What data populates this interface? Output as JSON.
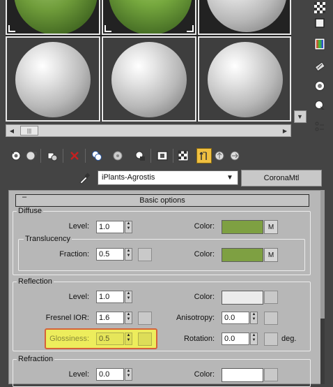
{
  "material": {
    "name": "iPlants-Agrostis",
    "type_button": "CoronaMtl"
  },
  "rollout": {
    "minus": "–",
    "title": "Basic options"
  },
  "diffuse": {
    "group": "Diffuse",
    "level_label": "Level:",
    "level_value": "1.0",
    "color_label": "Color:",
    "color": "#7ea042",
    "map_btn": "M"
  },
  "translucency": {
    "group": "Translucency",
    "fraction_label": "Fraction:",
    "fraction_value": "0.5",
    "color_label": "Color:",
    "color": "#7ea042",
    "map_btn": "M"
  },
  "reflection": {
    "group": "Reflection",
    "level_label": "Level:",
    "level_value": "1.0",
    "color_label": "Color:",
    "color": "#ececec",
    "fresnel_label": "Fresnel IOR:",
    "fresnel_value": "1.6",
    "anisotropy_label": "Anisotropy:",
    "anisotropy_value": "0.0",
    "glossiness_label": "Glossiness:",
    "glossiness_value": "0.5",
    "rotation_label": "Rotation:",
    "rotation_value": "0.0",
    "rotation_unit": "deg."
  },
  "refraction": {
    "group": "Refraction",
    "level_label": "Level:",
    "level_value": "0.0",
    "color_label": "Color:",
    "color": "#ffffff"
  },
  "colors": {
    "panel_bg": "#b7b7b7",
    "highlight": "#eded5c",
    "highlight_border": "#d5623a",
    "diffuse_green": "#7ea042"
  }
}
